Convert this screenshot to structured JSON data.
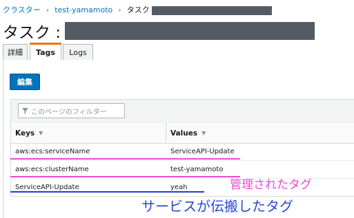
{
  "breadcrumb": {
    "items": [
      {
        "label": "クラスター",
        "link": true
      },
      {
        "label": "test-yamamoto",
        "link": true
      },
      {
        "label": "タスク",
        "link": false
      }
    ],
    "separator": "›"
  },
  "page_title": "タスク :",
  "tabs": [
    {
      "label": "詳細",
      "active": false
    },
    {
      "label": "Tags",
      "active": true
    },
    {
      "label": "Logs",
      "active": false
    }
  ],
  "edit_button": "編集",
  "filter": {
    "placeholder": "このページのフィルター"
  },
  "table": {
    "headers": {
      "keys": "Keys",
      "values": "Values"
    },
    "rows": [
      {
        "key": "aws:ecs:serviceName",
        "value": "ServiceAPI-Update"
      },
      {
        "key": "aws:ecs:clusterName",
        "value": "test-yamamoto"
      },
      {
        "key": "ServiceAPI-Update",
        "value": "yeah"
      }
    ]
  },
  "annotations": {
    "managed_tags": "管理されたタグ",
    "propagated_tags": "サービスが伝搬したタグ"
  },
  "colors": {
    "link": "#0073bb",
    "primary_button": "#0073bb",
    "active_tab_accent": "#ec7211",
    "annotation_pink": "#e84ad3",
    "annotation_blue": "#2847d8"
  }
}
